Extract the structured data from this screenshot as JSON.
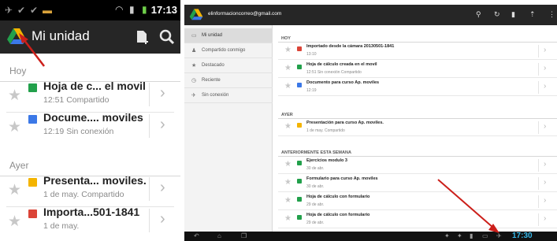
{
  "phone": {
    "status": {
      "time": "17:13"
    },
    "title": "Mi unidad",
    "sections": [
      {
        "label": "Hoy"
      },
      {
        "label": "Ayer"
      }
    ],
    "rows": [
      {
        "title": "Hoja de c... el movil",
        "sub": "12:51  Compartido",
        "icon_color": "#22a04b"
      },
      {
        "title": "Docume.... moviles",
        "sub": "12:19  Sin conexión",
        "icon_color": "#3b78e7"
      },
      {
        "title": "Presenta... moviles.",
        "sub": "1 de may.  Compartido",
        "icon_color": "#f4b400"
      },
      {
        "title": "Importa...501-1841",
        "sub": "1 de may.",
        "icon_color": "#db4437"
      }
    ]
  },
  "tablet": {
    "account": "elinformacioncorreo@gmail.com",
    "sidebar": [
      {
        "label": "Mi unidad",
        "icon": "folder-icon"
      },
      {
        "label": "Compartido conmigo",
        "icon": "people-icon"
      },
      {
        "label": "Destacado",
        "icon": "star-icon"
      },
      {
        "label": "Reciente",
        "icon": "clock-icon"
      },
      {
        "label": "Sin conexión",
        "icon": "pin-icon"
      }
    ],
    "sections": [
      {
        "label": "HOY"
      },
      {
        "label": "AYER"
      },
      {
        "label": "ANTERIORMENTE ESTA SEMANA"
      }
    ],
    "rows": [
      {
        "title": "Importado desde la cámara 20130501-1841",
        "sub": "13:10",
        "icon_color": "#db4437"
      },
      {
        "title": "Hoja de cálculo creada en el movil",
        "sub": "12:51  Sin conexión  Compartido",
        "icon_color": "#22a04b"
      },
      {
        "title": "Documento para curso Ap. moviles",
        "sub": "12:19",
        "icon_color": "#3b78e7"
      },
      {
        "title": "Presentación para curso Ap. moviles.",
        "sub": "1 de may.  Compartido",
        "icon_color": "#f4b400"
      },
      {
        "title": "Ejercicios modulo 3",
        "sub": "30 de abr.",
        "icon_color": "#22a04b"
      },
      {
        "title": "Formulario para curso Ap. moviles",
        "sub": "30 de abr.",
        "icon_color": "#22a04b"
      },
      {
        "title": "Hoja de cálculo con formulario",
        "sub": "29 de abr.",
        "icon_color": "#22a04b"
      },
      {
        "title": "Hoja de cálculo con formulario",
        "sub": "29 de abr.",
        "icon_color": "#22a04b"
      }
    ],
    "navbar": {
      "time": "17:30"
    }
  }
}
